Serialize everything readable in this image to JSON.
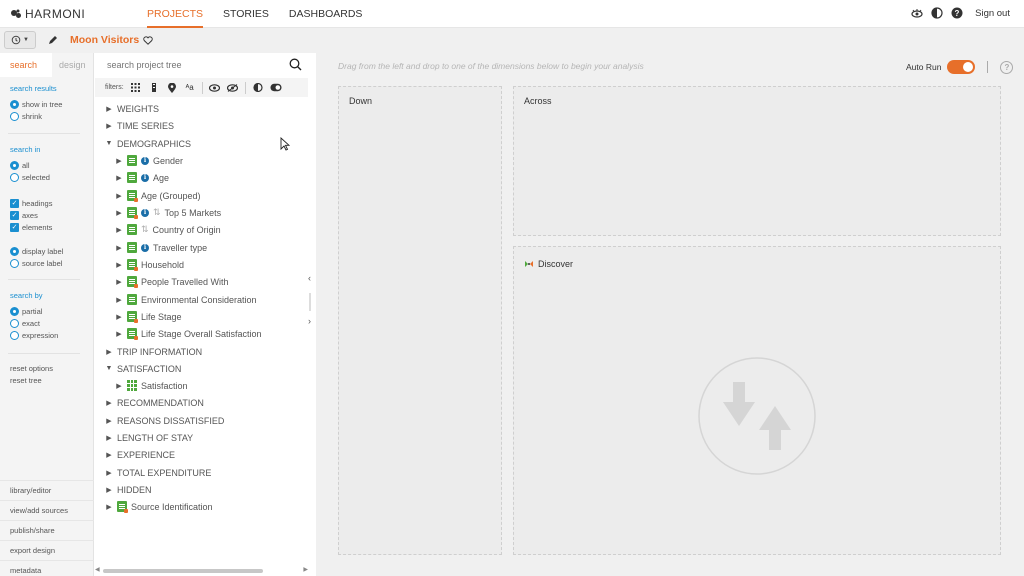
{
  "app": {
    "logo_text": "HARMONI"
  },
  "nav": {
    "tabs": [
      "PROJECTS",
      "STORIES",
      "DASHBOARDS"
    ],
    "active": "PROJECTS"
  },
  "topright": {
    "signout": "Sign out",
    "icons": [
      "eye-icon",
      "contrast-icon",
      "help-icon"
    ]
  },
  "project": {
    "title": "Moon Visitors"
  },
  "left_tabs": {
    "search": "search",
    "design": "design"
  },
  "search_options": {
    "results_head": "search results",
    "results": [
      {
        "label": "show in tree",
        "checked": true
      },
      {
        "label": "shrink",
        "checked": false
      }
    ],
    "in_head": "search in",
    "in_scope": [
      {
        "label": "all",
        "checked": true
      },
      {
        "label": "selected",
        "checked": false
      }
    ],
    "in_types": [
      {
        "label": "headings",
        "checked": true
      },
      {
        "label": "axes",
        "checked": true
      },
      {
        "label": "elements",
        "checked": true
      }
    ],
    "label_type": [
      {
        "label": "display label",
        "checked": true
      },
      {
        "label": "source label",
        "checked": false
      }
    ],
    "by_head": "search by",
    "by": [
      {
        "label": "partial",
        "checked": true
      },
      {
        "label": "exact",
        "checked": false
      },
      {
        "label": "expression",
        "checked": false
      }
    ],
    "reset_options": "reset options",
    "reset_tree": "reset tree"
  },
  "bottom_links": [
    "library/editor",
    "view/add sources",
    "publish/share",
    "export design",
    "metadata"
  ],
  "tree_search": {
    "placeholder": "search project tree"
  },
  "filters": {
    "label": "filters:"
  },
  "tree": [
    {
      "label": "WEIGHTS",
      "level": 0,
      "expanded": false
    },
    {
      "label": "TIME SERIES",
      "level": 0,
      "expanded": false
    },
    {
      "label": "DEMOGRAPHICS",
      "level": 0,
      "expanded": true
    },
    {
      "label": "Gender",
      "level": 1,
      "icon": "var",
      "info": true
    },
    {
      "label": "Age",
      "level": 1,
      "icon": "var",
      "info": true
    },
    {
      "label": "Age (Grouped)",
      "level": 1,
      "icon": "var-orange"
    },
    {
      "label": "Top 5 Markets",
      "level": 1,
      "icon": "var-orange",
      "info": true,
      "sort": true
    },
    {
      "label": "Country of Origin",
      "level": 1,
      "icon": "var",
      "sort": true
    },
    {
      "label": "Traveller type",
      "level": 1,
      "icon": "var",
      "info": true
    },
    {
      "label": "Household",
      "level": 1,
      "icon": "var-orange"
    },
    {
      "label": "People Travelled With",
      "level": 1,
      "icon": "var-orange"
    },
    {
      "label": "Environmental Consideration",
      "level": 1,
      "icon": "var"
    },
    {
      "label": "Life Stage",
      "level": 1,
      "icon": "var-orange"
    },
    {
      "label": "Life Stage Overall Satisfaction",
      "level": 1,
      "icon": "var-orange"
    },
    {
      "label": "TRIP INFORMATION",
      "level": 0,
      "expanded": false
    },
    {
      "label": "SATISFACTION",
      "level": 0,
      "expanded": true
    },
    {
      "label": "Satisfaction",
      "level": 1,
      "icon": "grid"
    },
    {
      "label": "RECOMMENDATION",
      "level": 0,
      "expanded": false
    },
    {
      "label": "REASONS DISSATISFIED",
      "level": 0,
      "expanded": false
    },
    {
      "label": "LENGTH OF STAY",
      "level": 0,
      "expanded": false
    },
    {
      "label": "EXPERIENCE",
      "level": 0,
      "expanded": false
    },
    {
      "label": "TOTAL EXPENDITURE",
      "level": 0,
      "expanded": false
    },
    {
      "label": "HIDDEN",
      "level": 0,
      "expanded": false
    },
    {
      "label": "Source Identification",
      "level": 0,
      "icon": "var-orange",
      "leaf": true
    }
  ],
  "main": {
    "hint": "Drag from the left and drop to one of the dimensions below to begin your analysis",
    "autorun_label": "Auto Run",
    "autorun_on": true,
    "down_label": "Down",
    "across_label": "Across",
    "discover_label": "Discover"
  },
  "colors": {
    "accent": "#e76f2a",
    "link": "#1a8fd0",
    "variable": "#4fa83d"
  }
}
